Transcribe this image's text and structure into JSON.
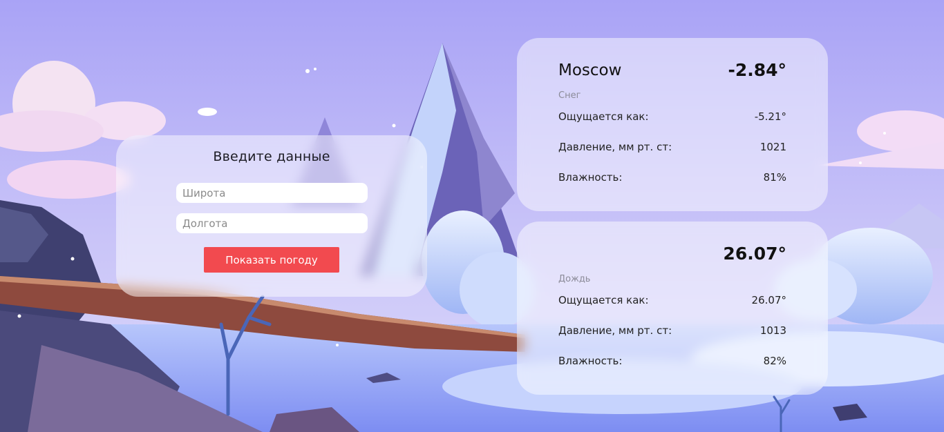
{
  "input_form": {
    "title": "Введите данные",
    "latitude_placeholder": "Широта",
    "longitude_placeholder": "Долгота",
    "latitude_value": "",
    "longitude_value": "",
    "submit_label": "Показать погоду",
    "submit_color": "#f24a4f"
  },
  "weather_cards": [
    {
      "city": "Moscow",
      "temperature": "-2.84°",
      "description": "Снег",
      "feels_like_label": "Ощущается как:",
      "feels_like_value": "-5.21°",
      "pressure_label": "Давление, мм рт. ст:",
      "pressure_value": "1021",
      "humidity_label": "Влажность:",
      "humidity_value": "81%"
    },
    {
      "city": "",
      "temperature": "26.07°",
      "description": "Дождь",
      "feels_like_label": "Ощущается как:",
      "feels_like_value": "26.07°",
      "pressure_label": "Давление, мм рт. ст:",
      "pressure_value": "1013",
      "humidity_label": "Влажность:",
      "humidity_value": "82%"
    }
  ]
}
